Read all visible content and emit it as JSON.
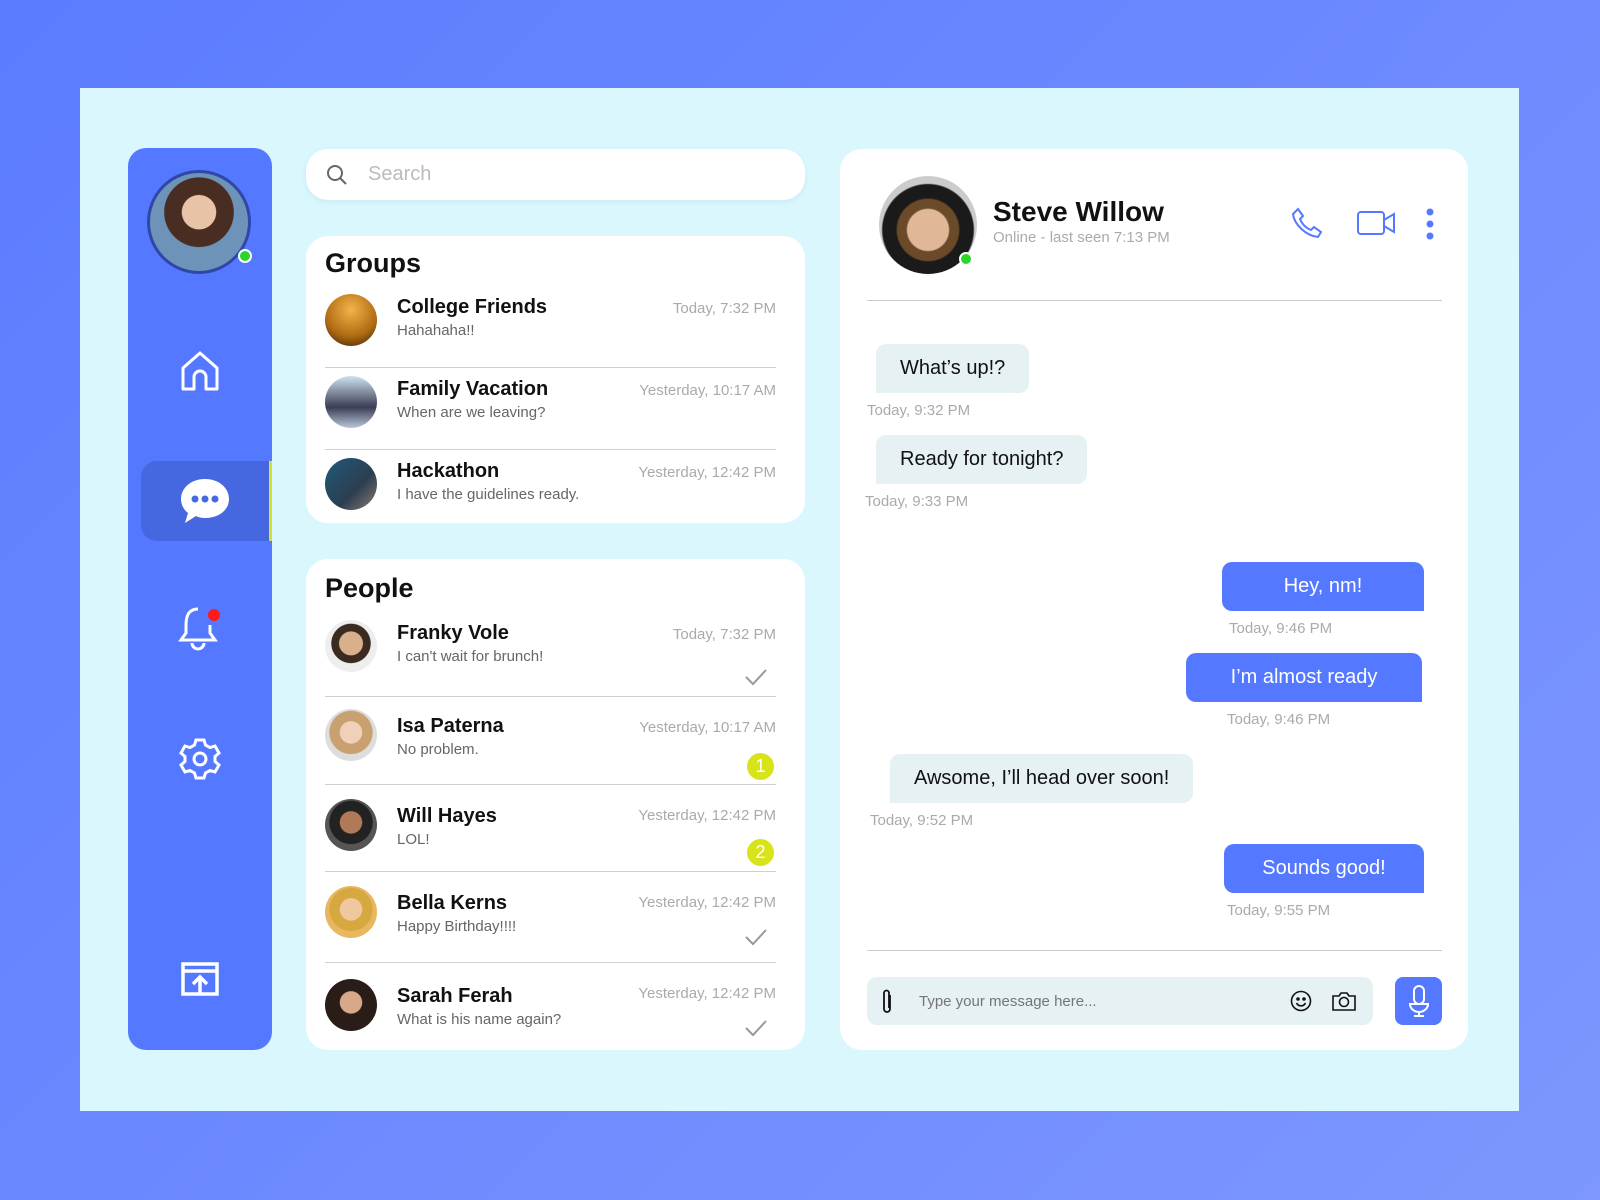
{
  "search": {
    "placeholder": "Search"
  },
  "groups": {
    "title": "Groups",
    "items": [
      {
        "name": "College Friends",
        "preview": "Hahahaha!!",
        "time": "Today, 7:32 PM"
      },
      {
        "name": "Family Vacation",
        "preview": "When are we leaving?",
        "time": "Yesterday, 10:17 AM"
      },
      {
        "name": "Hackathon",
        "preview": "I have the guidelines ready.",
        "time": "Yesterday, 12:42 PM"
      }
    ]
  },
  "people": {
    "title": "People",
    "items": [
      {
        "name": "Franky Vole",
        "preview": "I can't wait for brunch!",
        "time": "Today, 7:32 PM",
        "status": "read"
      },
      {
        "name": "Isa Paterna",
        "preview": "No problem.",
        "time": "Yesterday, 10:17 AM",
        "unread": "1"
      },
      {
        "name": "Will Hayes",
        "preview": "LOL!",
        "time": "Yesterday, 12:42 PM",
        "unread": "2"
      },
      {
        "name": "Bella Kerns",
        "preview": "Happy Birthday!!!!",
        "time": "Yesterday, 12:42 PM",
        "status": "read"
      },
      {
        "name": "Sarah Ferah",
        "preview": "What is his name again?",
        "time": "Yesterday, 12:42 PM",
        "status": "read"
      }
    ]
  },
  "chat": {
    "contact": "Steve Willow",
    "status": "Online - last seen 7:13 PM",
    "messages": [
      {
        "text": "What’s up!?",
        "time": "Today, 9:32 PM",
        "dir": "in"
      },
      {
        "text": "Ready for tonight?",
        "time": "Today, 9:33 PM",
        "dir": "in"
      },
      {
        "text": "Hey, nm!",
        "time": "Today, 9:46 PM",
        "dir": "out"
      },
      {
        "text": "I’m almost ready",
        "time": "Today, 9:46 PM",
        "dir": "out"
      },
      {
        "text": "Awsome, I’ll head over soon!",
        "time": "Today, 9:52 PM",
        "dir": "in"
      },
      {
        "text": "Sounds good!",
        "time": "Today, 9:55 PM",
        "dir": "out"
      }
    ],
    "input_placeholder": "Type your message here..."
  },
  "colors": {
    "accent": "#5478ff",
    "online": "#2bd62b",
    "badge": "#d8e31a",
    "notification": "#ff1a1a"
  }
}
